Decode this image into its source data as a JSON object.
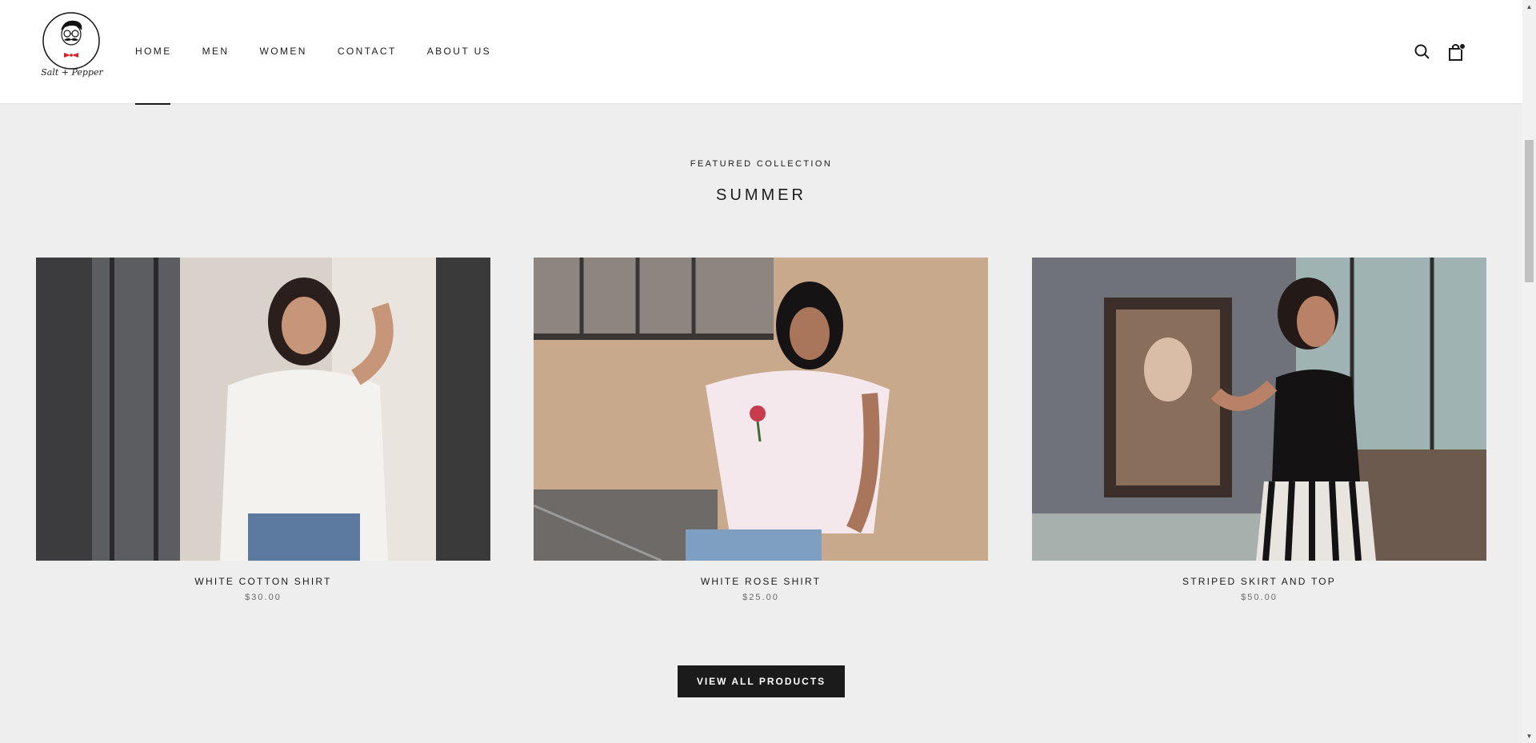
{
  "brand": {
    "logo_text": "Salt + Pepper"
  },
  "nav": {
    "items": [
      {
        "label": "HOME"
      },
      {
        "label": "MEN"
      },
      {
        "label": "WOMEN"
      },
      {
        "label": "CONTACT"
      },
      {
        "label": "ABOUT US"
      }
    ],
    "active": "HOME"
  },
  "header_icons": [
    "search-icon",
    "cart-icon"
  ],
  "collection": {
    "subheading": "FEATURED COLLECTION",
    "heading": "SUMMER",
    "products": [
      {
        "title": "WHITE COTTON SHIRT",
        "price": "$30.00"
      },
      {
        "title": "WHITE ROSE SHIRT",
        "price": "$25.00"
      },
      {
        "title": "STRIPED SKIRT AND TOP",
        "price": "$50.00"
      }
    ],
    "button_label": "VIEW ALL PRODUCTS"
  },
  "colors": {
    "background": "#eeeeee",
    "header": "#ffffff",
    "text": "#1c1b1b",
    "price": "#6a6a6a",
    "button": "#1c1b1b",
    "logo_bowtie": "#e02020"
  }
}
